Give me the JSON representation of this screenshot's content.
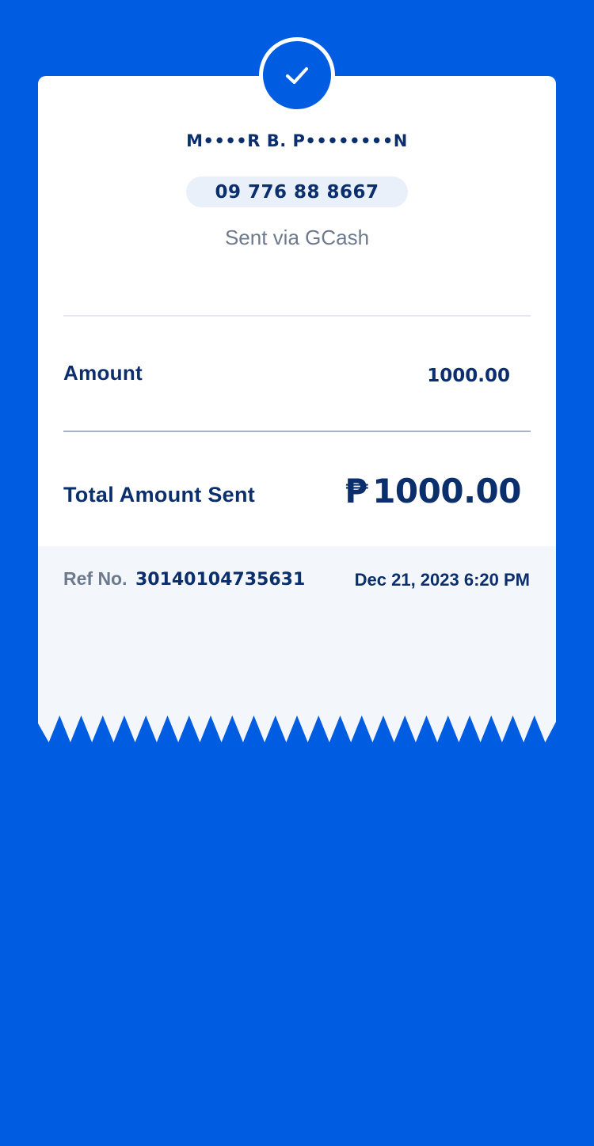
{
  "receipt": {
    "recipient_name": "M••••R B. P••••••••N",
    "recipient_phone": "09 776 88 8667",
    "sent_via": "Sent via GCash",
    "amount_label": "Amount",
    "amount_value": "1000.00",
    "total_label": "Total Amount Sent",
    "currency_symbol": "₱",
    "total_value": "1000.00",
    "ref_label": "Ref No.",
    "ref_number": "30140104735631",
    "date_time": "Dec 21, 2023 6:20 PM",
    "status_icon": "checkmark-icon"
  },
  "colors": {
    "brand_blue": "#005ce1",
    "text_navy": "#0b2f6d",
    "text_gray": "#6d7a8e",
    "card_bg": "#ffffff",
    "footer_bg": "#f3f6fb"
  }
}
